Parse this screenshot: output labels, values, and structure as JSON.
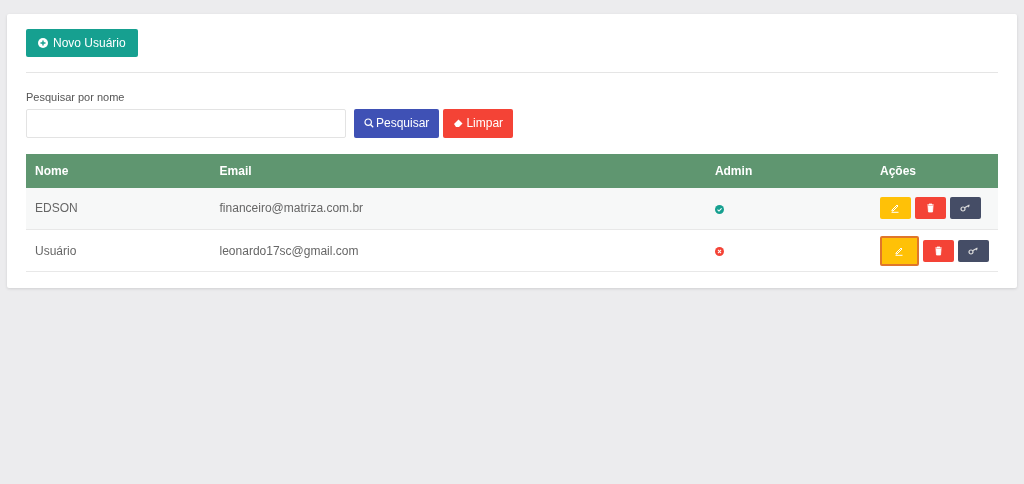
{
  "new_button": {
    "label": "Novo Usuário"
  },
  "search": {
    "label": "Pesquisar por nome",
    "search_button": "Pesquisar",
    "clear_button": "Limpar"
  },
  "table": {
    "columns": [
      "Nome",
      "Email",
      "Admin",
      "Ações"
    ],
    "rows": [
      {
        "name": "EDSON",
        "email": "financeiro@matriza.com.br",
        "admin": true,
        "edit_highlighted": false
      },
      {
        "name": "Usuário",
        "email": "leonardo17sc@gmail.com",
        "admin": false,
        "edit_highlighted": true
      }
    ]
  }
}
